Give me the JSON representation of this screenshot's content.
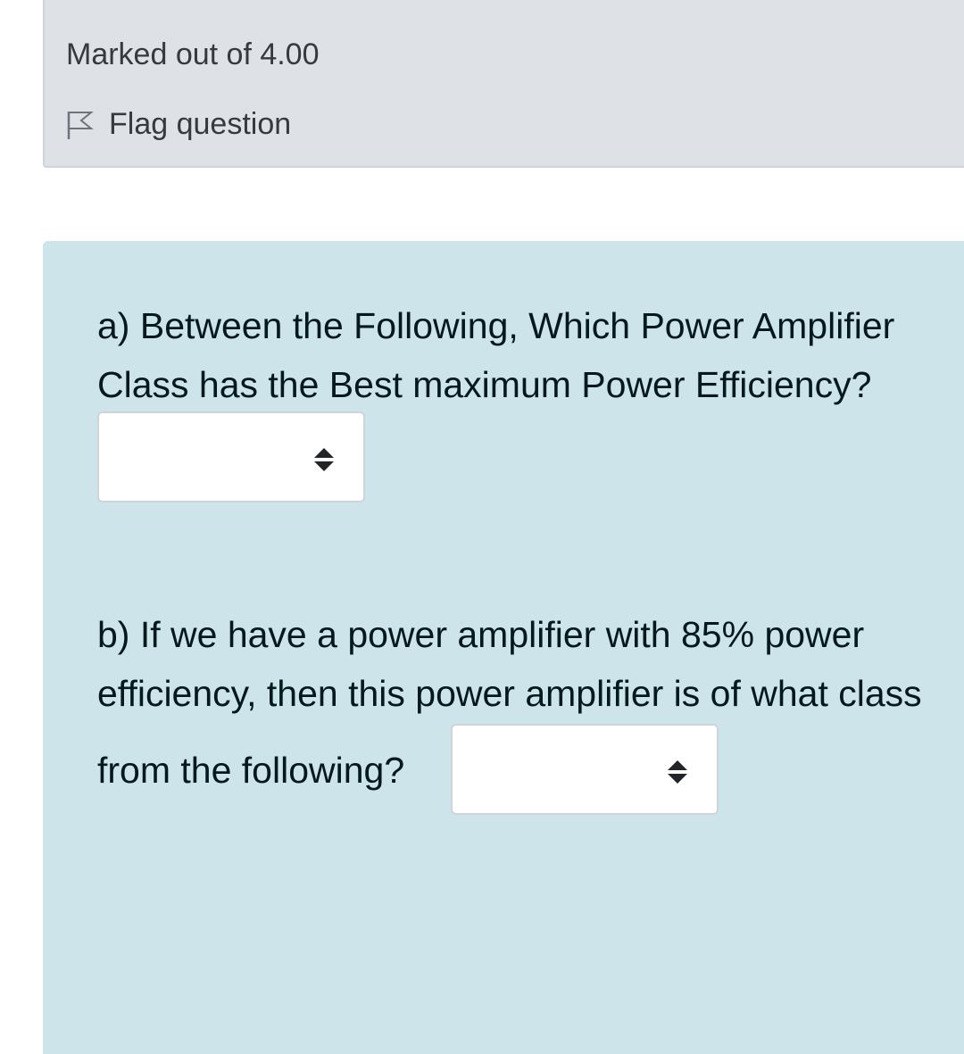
{
  "info": {
    "marks_text": "Marked out of 4.00",
    "flag_label": "Flag question",
    "flag_icon": "flag-outline-icon"
  },
  "question": {
    "part_a": {
      "line1": "a) Between the Following, Which Power Amplifier",
      "line2": "Class has the Best maximum Power Efficiency?",
      "select_value": "",
      "select_icon": "sort-arrows-icon"
    },
    "part_b": {
      "line1": "b) If we have a power amplifier with 85% power",
      "line2": "efficiency, then this power amplifier is of what class",
      "line3": "from the following?",
      "select_value": "",
      "select_icon": "sort-arrows-icon"
    }
  },
  "colors": {
    "info_background": "#dee2e6",
    "formulation_background": "#cde5ea",
    "question_text": "#001a1e"
  }
}
